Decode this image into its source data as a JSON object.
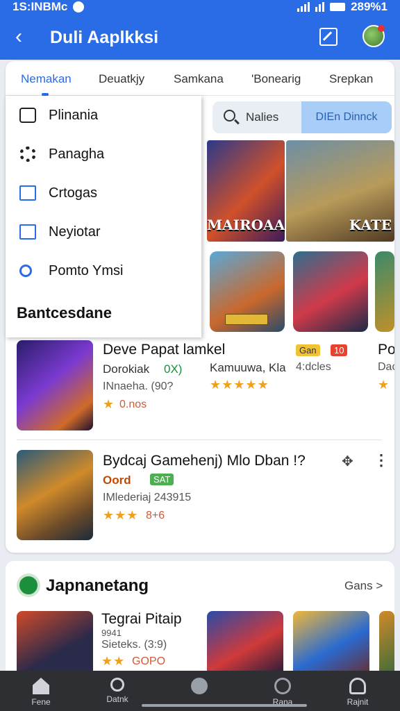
{
  "status_bar": {
    "left_text": "1S:INBMc",
    "right_text": "289%1"
  },
  "app_bar": {
    "title": "Duli Aaplkksi"
  },
  "tabs": [
    {
      "label": "Nemakan",
      "active": true
    },
    {
      "label": "Deuatkjy",
      "active": false
    },
    {
      "label": "Samkana",
      "active": false
    },
    {
      "label": "'Bonearig",
      "active": false
    },
    {
      "label": "Srepkan",
      "active": false
    }
  ],
  "search": {
    "placeholder": "Nalies",
    "button_label": "DIEn Dinnck"
  },
  "banners": [
    {
      "caption": "MAIROAAI"
    },
    {
      "caption": "KATE"
    }
  ],
  "menu": {
    "items": [
      {
        "label": "Plinania",
        "icon": "box-icon"
      },
      {
        "label": "Panagha",
        "icon": "gear-icon"
      },
      {
        "label": "Crtogas",
        "icon": "folder-icon"
      },
      {
        "label": "Neyiotar",
        "icon": "card-icon"
      },
      {
        "label": "Pomto Ymsi",
        "icon": "search-icon"
      }
    ],
    "section_label": "Bantcesdane"
  },
  "list": [
    {
      "title": "Deve Papat lamkel",
      "subtitle": "Dorokiak",
      "badge": "0X)",
      "meta": "INnaeha. (90?",
      "rating_text": "0.nos"
    },
    {
      "title": "Bydcaj Gamehenj) Mlo Dban !?",
      "subtitle": "Oord",
      "badge": "SAT",
      "meta": "IMlederiaj 243915",
      "rating_text": "8+6"
    }
  ],
  "side_items": [
    {
      "badge_a": "Gan",
      "badge_b": "10",
      "label": "Kamuuwa, Kla",
      "sub": "4:dcles"
    },
    {
      "label": "Po",
      "sub": "Dao"
    }
  ],
  "section2": {
    "title": "Japnanetang",
    "more_label": "Gans >",
    "item": {
      "title": "Tegrai Pitaip",
      "code": "9941",
      "meta": "Sieteks. (3:9)",
      "rating_text": "GOPO"
    }
  },
  "bottom_nav": [
    {
      "label": "Fene",
      "icon": "home-icon"
    },
    {
      "label": "Datnk",
      "icon": "search-icon"
    },
    {
      "label": "",
      "icon": "circle-icon"
    },
    {
      "label": "Rana",
      "icon": "heart-icon"
    },
    {
      "label": "Rajnit",
      "icon": "user-icon"
    }
  ],
  "colors": {
    "primary": "#2a6be6",
    "search_button": "#a8cdf6",
    "nav_bg": "#2d2f33"
  }
}
